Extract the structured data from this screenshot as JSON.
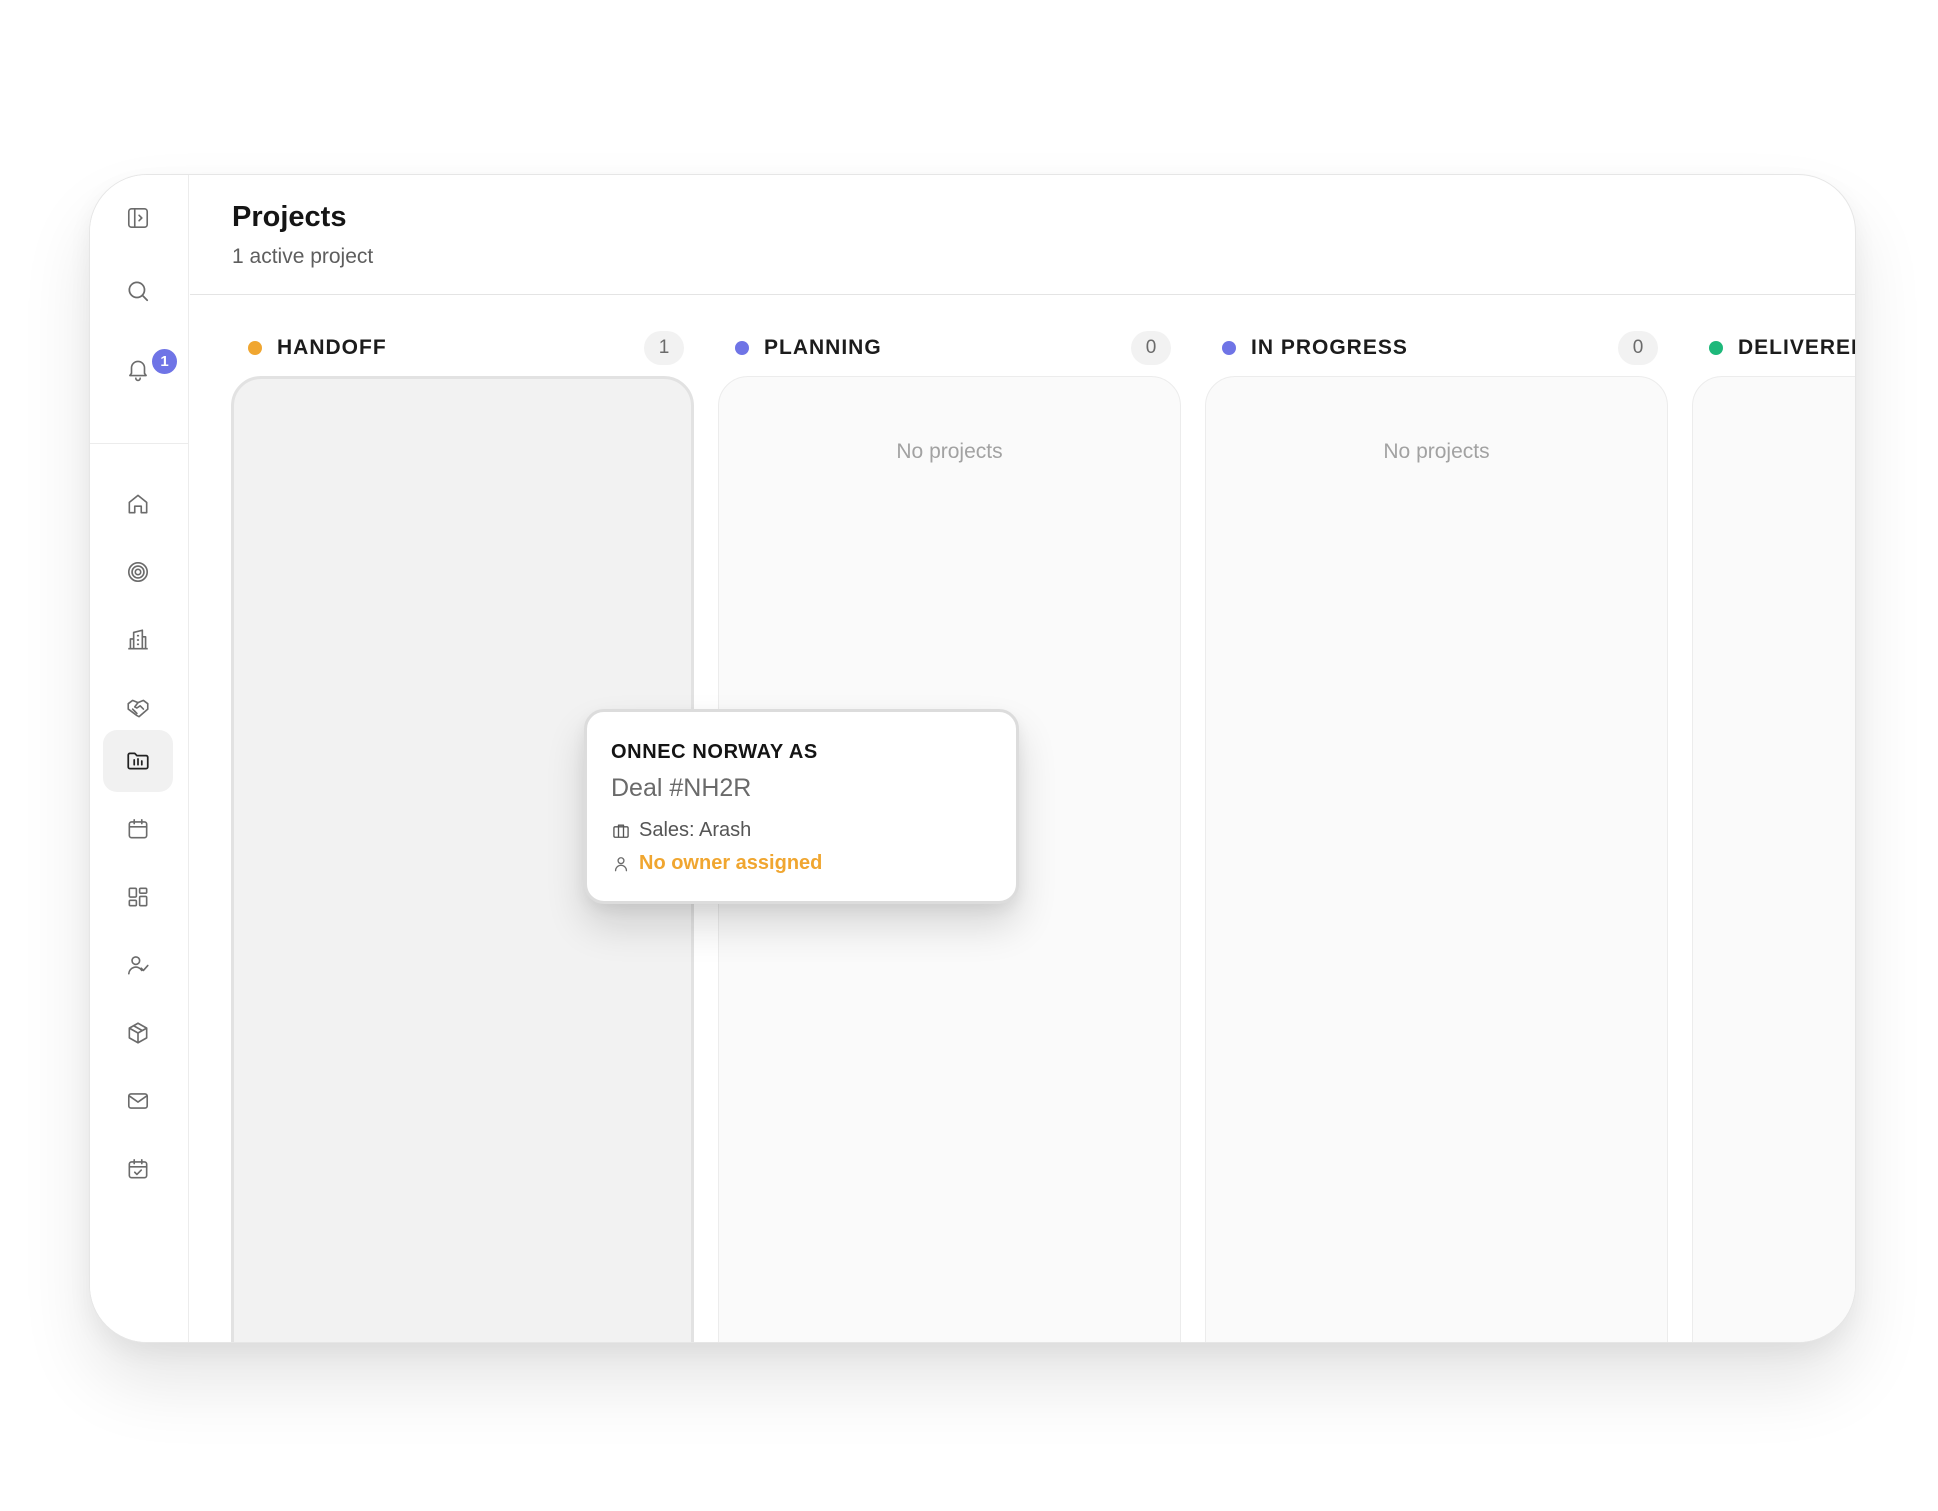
{
  "notifications": {
    "count": "1"
  },
  "header": {
    "title": "Projects",
    "subtitle": "1 active project"
  },
  "sidebar": {
    "items": [
      {
        "name": "toggle-sidebar",
        "icon": "panel-toggle-icon"
      },
      {
        "name": "search",
        "icon": "search-icon"
      },
      {
        "name": "notifications",
        "icon": "bell-icon"
      },
      {
        "name": "home",
        "icon": "home-icon"
      },
      {
        "name": "targets",
        "icon": "target-icon"
      },
      {
        "name": "companies",
        "icon": "building-icon"
      },
      {
        "name": "deals",
        "icon": "handshake-icon"
      },
      {
        "name": "projects",
        "icon": "folder-chart-icon",
        "active": true
      },
      {
        "name": "calendar",
        "icon": "calendar-icon"
      },
      {
        "name": "dashboards",
        "icon": "grid-icon"
      },
      {
        "name": "contacts",
        "icon": "user-check-icon"
      },
      {
        "name": "products",
        "icon": "box-icon"
      },
      {
        "name": "mail",
        "icon": "mail-icon"
      },
      {
        "name": "tasks",
        "icon": "calendar-check-icon"
      }
    ]
  },
  "columns": [
    {
      "title": "HANDOFF",
      "count": "1",
      "color": "#f0a630",
      "empty_text": ""
    },
    {
      "title": "PLANNING",
      "count": "0",
      "color": "#6f74e6",
      "empty_text": "No projects"
    },
    {
      "title": "IN PROGRESS",
      "count": "0",
      "color": "#6f74e6",
      "empty_text": "No projects"
    },
    {
      "title": "DELIVERED",
      "count": "",
      "color": "#1db87a",
      "empty_text": ""
    }
  ],
  "card": {
    "company": "ONNEC NORWAY AS",
    "deal": "Deal #NH2R",
    "sales": "Sales: Arash",
    "owner": "No owner assigned"
  },
  "colors": {
    "accent": "#6f74e6",
    "warning": "#f0a630",
    "success": "#1db87a"
  }
}
